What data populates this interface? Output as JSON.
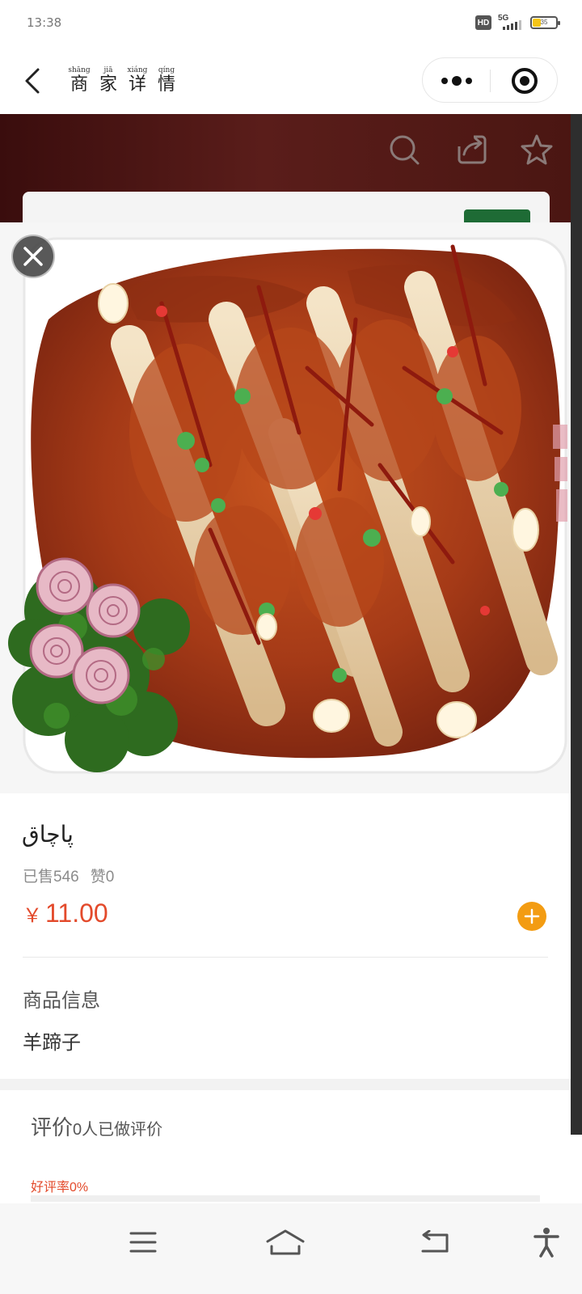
{
  "status_bar": {
    "time": "13:38",
    "hd_label": "HD",
    "network": "5G",
    "signal_level": 4,
    "battery_percent": 35,
    "battery_label": "35"
  },
  "nav": {
    "title_chars": [
      {
        "pinyin": "shāng",
        "hanzi": "商"
      },
      {
        "pinyin": "jiā",
        "hanzi": "家"
      },
      {
        "pinyin": "xiáng",
        "hanzi": "详"
      },
      {
        "pinyin": "qíng",
        "hanzi": "情"
      }
    ]
  },
  "header_icons": [
    "search-icon",
    "share-icon",
    "star-icon"
  ],
  "dish": {
    "name": "پاچاق",
    "sold_label": "已售546",
    "likes_label": "赞0",
    "currency": "￥",
    "price": "11.00"
  },
  "product_info": {
    "heading": "商品信息",
    "description": "羊蹄子"
  },
  "reviews": {
    "title": "评价",
    "count_text": "0人已做评价",
    "good_rate_label": "好评率0%",
    "good_rate_value": 0
  },
  "colors": {
    "accent_red": "#e34a2b",
    "add_button_orange": "#f39c12",
    "header_maroon": "#4a1612"
  },
  "system_nav_icons": [
    "menu-icon",
    "home-icon",
    "back-icon",
    "accessibility-icon"
  ]
}
